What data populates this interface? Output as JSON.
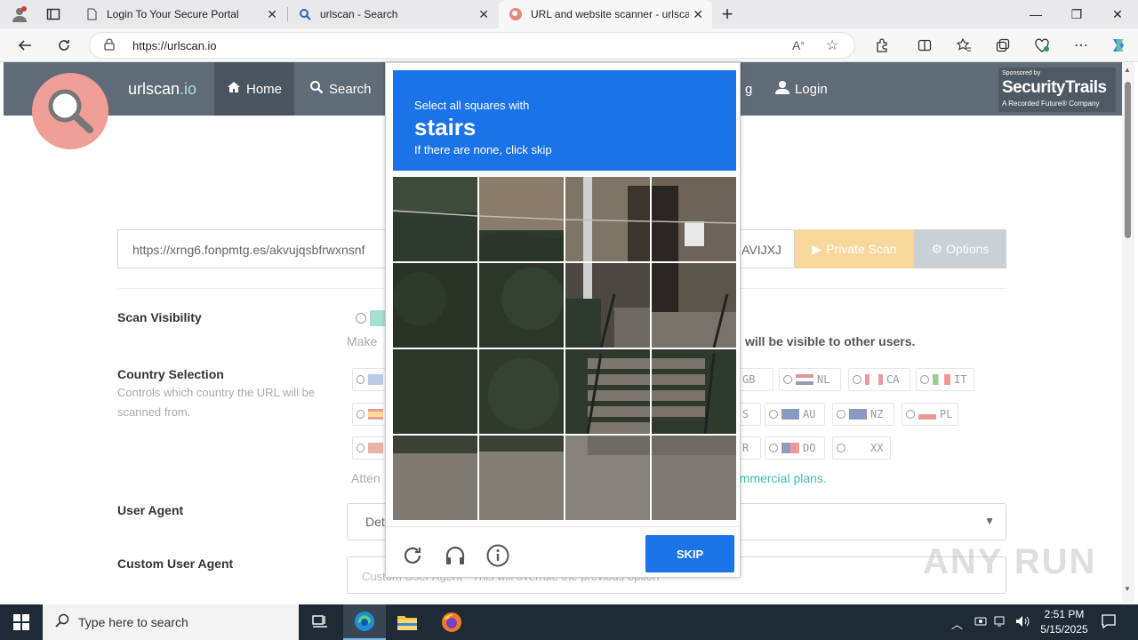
{
  "browser": {
    "tabs": [
      {
        "title": "Login To Your Secure Portal"
      },
      {
        "title": "urlscan - Search"
      },
      {
        "title": "URL and website scanner - urlsca"
      }
    ],
    "address": "https://urlscan.io",
    "new_tab_glyph": "+"
  },
  "site": {
    "brand_main": "urlscan",
    "brand_tld": ".io",
    "nav": {
      "home": "Home",
      "search": "Search",
      "partial": "g",
      "login": "Login"
    },
    "sponsor": {
      "label": "Sponsored by",
      "name": "SecurityTrails",
      "tagline": "A Recorded Future® Company"
    },
    "url_input_value": "https://xrng6.fonpmtg.es/akvujqsbfrwxnsnf",
    "url_input_tail": "AVIJXJ",
    "private_scan": "Private Scan",
    "options": "Options",
    "scan_visibility": "Scan Visibility",
    "visibility_hint_left": "Make",
    "visibility_hint_right_pre": "will be",
    "visibility_hint_right_bold": "visible to other users.",
    "country_selection": "Country Selection",
    "country_hint": "Controls which country the URL will be scanned from.",
    "countries_row1": [
      "GB",
      "NL",
      "CA",
      "IT"
    ],
    "countries_row2": [
      "S",
      "AU",
      "NZ",
      "PL"
    ],
    "countries_row3": [
      "R",
      "DO",
      "XX"
    ],
    "attention_left": "Atten",
    "attention_right": "ommercial plans.",
    "user_agent": "User Agent",
    "user_agent_value": "Det",
    "custom_user_agent": "Custom User Agent",
    "custom_ua_placeholder": "Custom User Agent - This will overrule the previous option"
  },
  "captcha": {
    "line1": "Select all squares with",
    "target": "stairs",
    "line3": "If there are none, click skip",
    "skip": "SKIP"
  },
  "watermark": "ANY RUN",
  "taskbar": {
    "search_placeholder": "Type here to search",
    "time": "2:51 PM",
    "date": "5/15/2025"
  },
  "colors": {
    "captcha_blue": "#1a73e8",
    "nav_bg": "#5f6b77",
    "private_scan": "#f8d79d"
  }
}
